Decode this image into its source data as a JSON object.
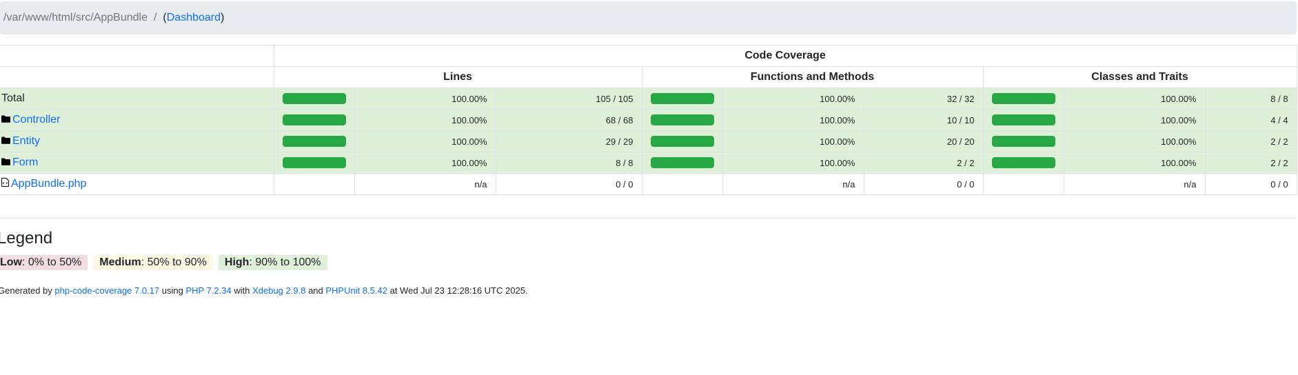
{
  "breadcrumb": {
    "path": "/var/www/html/src/AppBundle",
    "separator": "/",
    "paren_open": "(",
    "dashboard_label": "Dashboard",
    "paren_close": ")"
  },
  "table": {
    "super_header": "Code Coverage",
    "groups": [
      "Lines",
      "Functions and Methods",
      "Classes and Traits"
    ],
    "rows": [
      {
        "name": "Total",
        "kind": "total",
        "icon": "",
        "lines": {
          "progress": 100,
          "percent": "100.00%",
          "count": "105 / 105"
        },
        "functions": {
          "progress": 100,
          "percent": "100.00%",
          "count": "32 / 32"
        },
        "classes": {
          "progress": 100,
          "percent": "100.00%",
          "count": "8 / 8"
        }
      },
      {
        "name": "Controller",
        "kind": "dir",
        "icon": "folder-icon",
        "lines": {
          "progress": 100,
          "percent": "100.00%",
          "count": "68 / 68"
        },
        "functions": {
          "progress": 100,
          "percent": "100.00%",
          "count": "10 / 10"
        },
        "classes": {
          "progress": 100,
          "percent": "100.00%",
          "count": "4 / 4"
        }
      },
      {
        "name": "Entity",
        "kind": "dir",
        "icon": "folder-icon",
        "lines": {
          "progress": 100,
          "percent": "100.00%",
          "count": "29 / 29"
        },
        "functions": {
          "progress": 100,
          "percent": "100.00%",
          "count": "20 / 20"
        },
        "classes": {
          "progress": 100,
          "percent": "100.00%",
          "count": "2 / 2"
        }
      },
      {
        "name": "Form",
        "kind": "dir",
        "icon": "folder-icon",
        "lines": {
          "progress": 100,
          "percent": "100.00%",
          "count": "8 / 8"
        },
        "functions": {
          "progress": 100,
          "percent": "100.00%",
          "count": "2 / 2"
        },
        "classes": {
          "progress": 100,
          "percent": "100.00%",
          "count": "2 / 2"
        }
      },
      {
        "name": "AppBundle.php",
        "kind": "file",
        "icon": "file-code-icon",
        "lines": {
          "progress": null,
          "percent": "n/a",
          "count": "0 / 0"
        },
        "functions": {
          "progress": null,
          "percent": "n/a",
          "count": "0 / 0"
        },
        "classes": {
          "progress": null,
          "percent": "n/a",
          "count": "0 / 0"
        }
      }
    ]
  },
  "legend": {
    "title": "Legend",
    "low_label": "Low",
    "low_range": ": 0% to 50%",
    "medium_label": "Medium",
    "medium_range": ": 50% to 90%",
    "high_label": "High",
    "high_range": ": 90% to 100%"
  },
  "footer": {
    "prefix": "Generated by ",
    "coverage_link": "php-code-coverage 7.0.17",
    "using": " using ",
    "php_link": "PHP 7.2.34",
    "with": " with ",
    "xdebug_link": "Xdebug 2.9.8",
    "and": " and ",
    "phpunit_link": "PHPUnit 8.5.42",
    "suffix": " at Wed Jul 23 12:28:16 UTC 2025."
  },
  "colors": {
    "success_row": "#dff0d8",
    "bar_fill": "#28a745",
    "link": "#0d6efd",
    "low_bg": "#f2dede",
    "medium_bg": "#fcf8e3",
    "high_bg": "#dff0d8"
  }
}
